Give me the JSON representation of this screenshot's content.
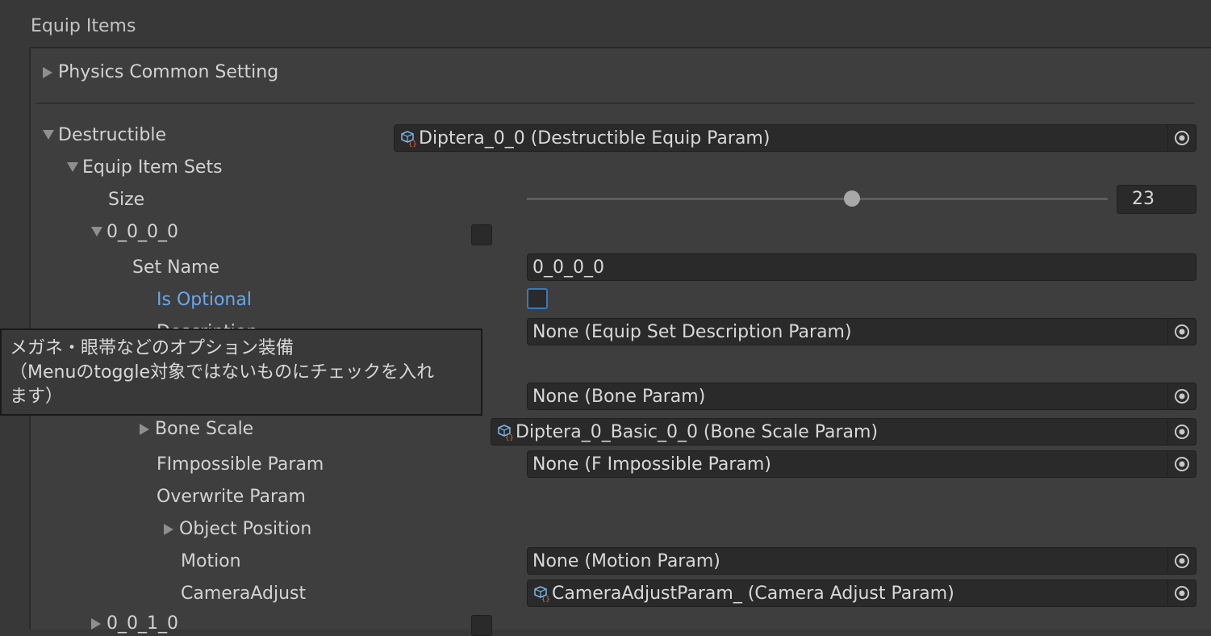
{
  "section_title": "Equip Items",
  "physics": {
    "label": "Physics Common Setting"
  },
  "destructible": {
    "label": "Destructible",
    "value": "Diptera_0_0 (Destructible Equip Param)"
  },
  "equip_item_sets": {
    "label": "Equip Item Sets",
    "size_label": "Size",
    "size_value": "23",
    "size_slider_fraction": 0.56
  },
  "set_0000": {
    "label": "0_0_0_0",
    "set_name_label": "Set Name",
    "set_name_value": "0_0_0_0",
    "is_optional_label": "Is Optional",
    "description_label": "Description",
    "description_value": "None (Equip Set Description Param)",
    "bone_value": "None (Bone Param)",
    "bone_scale_label": "Bone Scale",
    "bone_scale_value": "Diptera_0_Basic_0_0 (Bone Scale Param)",
    "fimpossible_label": "FImpossible Param",
    "fimpossible_value": "None (F Impossible Param)",
    "overwrite_label": "Overwrite Param",
    "object_position_label": "Object Position",
    "motion_label": "Motion",
    "motion_value": "None (Motion Param)",
    "camera_adjust_label": "CameraAdjust",
    "camera_adjust_value": "CameraAdjustParam_ (Camera Adjust Param)"
  },
  "next_set": {
    "label": "0_0_1_0"
  },
  "tooltip": {
    "line1": "メガネ・眼帯などのオプション装備",
    "line2": "（Menuのtoggle対象ではないものにチェックを入れ",
    "line3": "ます）"
  },
  "icons": {
    "collapsed": "triangle-right-icon",
    "expanded": "triangle-down-icon",
    "picker": "object-picker-icon",
    "asset": "scriptable-object-icon"
  },
  "colors": {
    "background": "#383838",
    "highlight": "#6aa7e8"
  }
}
